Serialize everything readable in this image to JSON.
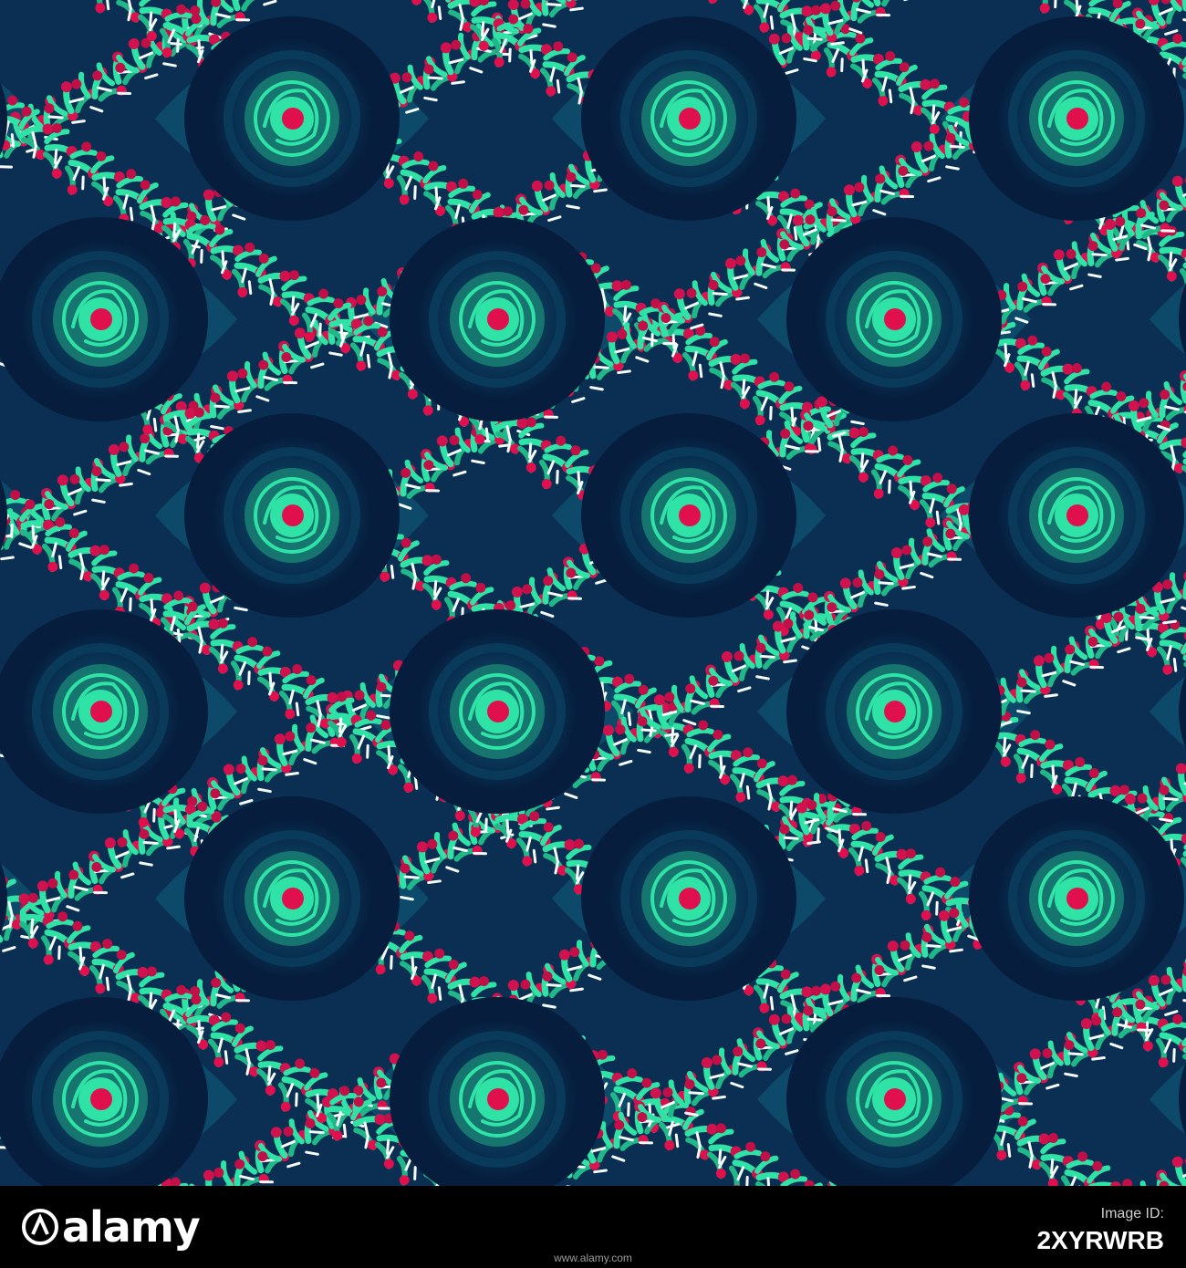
{
  "pattern": {
    "palette": {
      "navy": "#061d3d",
      "deep_teal": "#0b3f5c",
      "teal": "#16756f",
      "mint": "#2ee3a5",
      "magenta": "#e0104f",
      "white": "#f4fbf8"
    }
  },
  "watermark": {
    "logo_text": "alamy",
    "label": "Image ID:",
    "image_id": "2XYRWRB",
    "url": "www.alamy.com"
  }
}
